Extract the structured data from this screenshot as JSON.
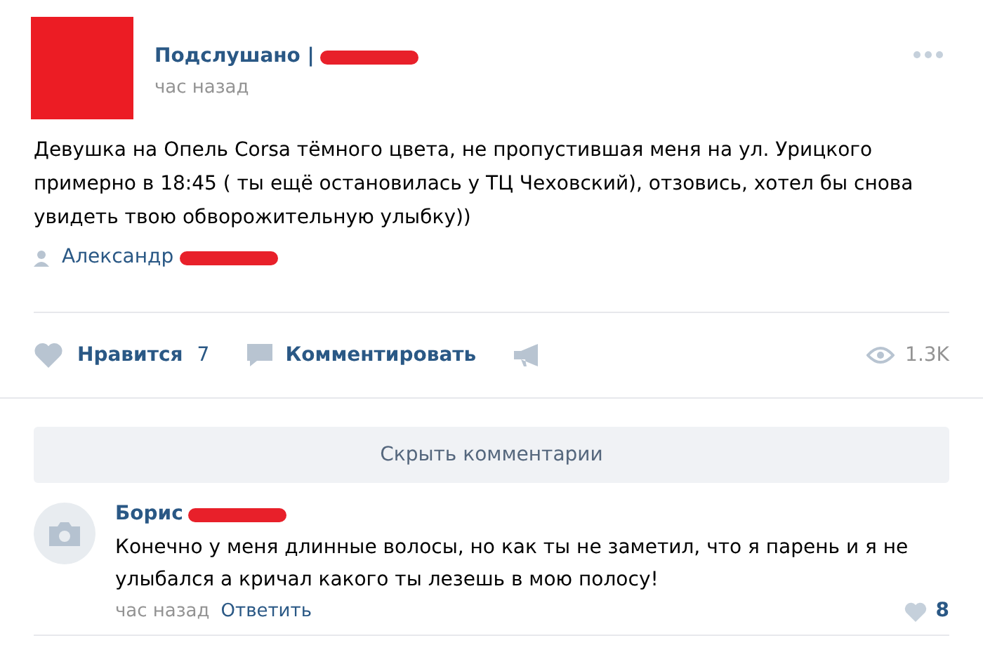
{
  "post": {
    "author": "Подслушано |",
    "time": "час назад",
    "text": "Девушка на Опель Corsa тёмного цвета, не пропустившая меня на ул. Урицкого примерно в 18:45 ( ты ещё остановилась у ТЦ Чеховский), отзовись, хотел бы снова увидеть твою обворожительную улыбку))",
    "signer": "Александр",
    "like_label": "Нравится",
    "like_count": "7",
    "comment_label": "Комментировать",
    "views": "1.3K"
  },
  "hide_comments": "Скрыть комментарии",
  "comments": [
    {
      "author": "Борис",
      "text": "Конечно у меня длинные волосы, но как ты не заметил, что я парень и я не улыбался а кричал какого ты лезешь в мою полосу!",
      "time": "час назад",
      "reply": "Ответить",
      "likes": "8"
    }
  ]
}
